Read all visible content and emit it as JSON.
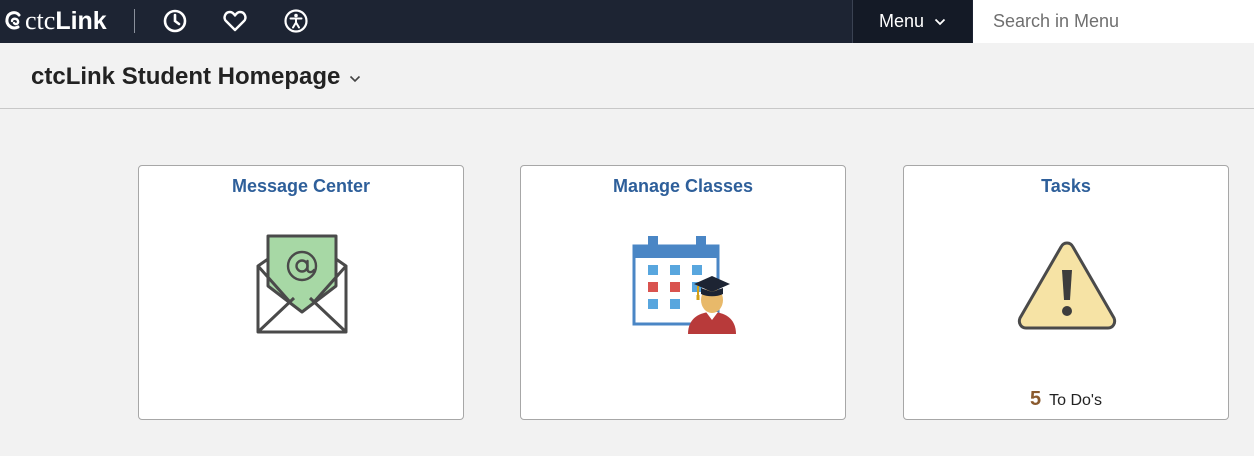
{
  "header": {
    "logo_ctc": "ctc",
    "logo_link": "Link",
    "menu_label": "Menu",
    "search_placeholder": "Search in Menu",
    "icons": [
      "clock-icon",
      "heart-icon",
      "accessibility-icon",
      "chevron-down-icon"
    ]
  },
  "page": {
    "title": "ctcLink Student Homepage"
  },
  "tiles": [
    {
      "title": "Message Center",
      "icon": "envelope-at-icon"
    },
    {
      "title": "Manage Classes",
      "icon": "calendar-student-icon"
    },
    {
      "title": "Tasks",
      "icon": "warning-icon",
      "count": "5",
      "count_label": "To Do's"
    }
  ],
  "colors": {
    "topbar": "#1d2433",
    "background": "#f2f2f2",
    "tile_title": "#2e5f9a",
    "count": "#8a5a2e",
    "warning_fill": "#f6e3a5"
  }
}
